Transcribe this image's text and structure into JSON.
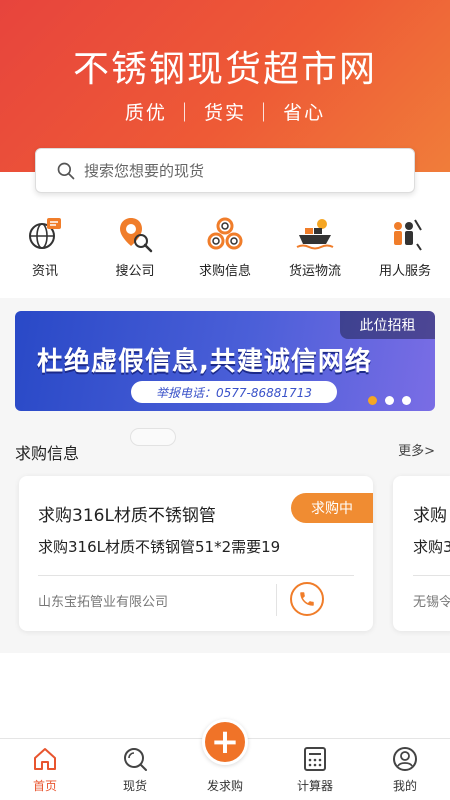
{
  "hero": {
    "title": "不锈钢现货超市网",
    "slogan": "质优 ｜ 货实 ｜ 省心"
  },
  "search": {
    "placeholder": "搜索您想要的现货",
    "icon": "search-icon"
  },
  "categories": [
    {
      "label": "资讯",
      "icon": "news-globe-icon"
    },
    {
      "label": "搜公司",
      "icon": "search-company-icon"
    },
    {
      "label": "求购信息",
      "icon": "purchase-pipes-icon"
    },
    {
      "label": "货运物流",
      "icon": "cargo-ship-icon"
    },
    {
      "label": "用人服务",
      "icon": "recruitment-icon"
    }
  ],
  "banner": {
    "tag": "此位招租",
    "headline": "杜绝虚假信息,共建诚信网络",
    "phone": "举报电话：0577-86881713",
    "active_index": 0,
    "slides": 3
  },
  "section": {
    "title": "求购信息",
    "more": "更多>"
  },
  "cards": [
    {
      "title": "求购316L材质不锈钢管",
      "status": "求购中",
      "description": "求购316L材质不锈钢管51*2需要19",
      "company": "山东宝拓管业有限公司"
    },
    {
      "title": "求购",
      "description": "求购3",
      "company": "无锡令"
    }
  ],
  "tabbar": [
    {
      "label": "首页",
      "icon": "home-icon",
      "active": true
    },
    {
      "label": "现货",
      "icon": "search-icon",
      "active": false
    },
    {
      "label": "发求购",
      "icon": "plus-icon",
      "active": false
    },
    {
      "label": "计算器",
      "icon": "calculator-icon",
      "active": false
    },
    {
      "label": "我的",
      "icon": "user-icon",
      "active": false
    }
  ],
  "colors": {
    "brand": "#e8552f",
    "badge": "#f08c32",
    "banner": "#3a52c9"
  }
}
